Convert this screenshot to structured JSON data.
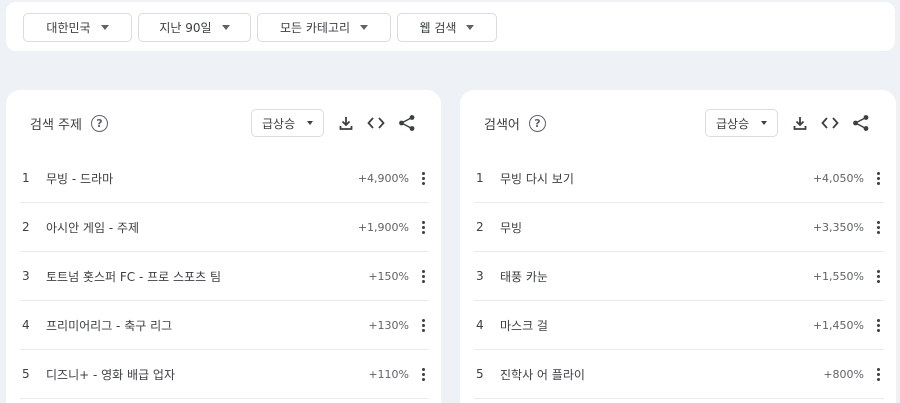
{
  "filters": [
    {
      "label": "대한민국"
    },
    {
      "label": "지난 90일"
    },
    {
      "label": "모든 카테고리"
    },
    {
      "label": "웹 검색"
    }
  ],
  "topics": {
    "title": "검색 주제",
    "sort_label": "급상승",
    "rows": [
      {
        "rank": "1",
        "label": "무빙 - 드라마",
        "value": "+4,900%"
      },
      {
        "rank": "2",
        "label": "아시안 게임 - 주제",
        "value": "+1,900%"
      },
      {
        "rank": "3",
        "label": "토트넘 홋스퍼 FC - 프로 스포츠 팀",
        "value": "+150%"
      },
      {
        "rank": "4",
        "label": "프리미어리그 - 축구 리그",
        "value": "+130%"
      },
      {
        "rank": "5",
        "label": "디즈니+ - 영화 배급 업자",
        "value": "+110%"
      }
    ]
  },
  "queries": {
    "title": "검색어",
    "sort_label": "급상승",
    "rows": [
      {
        "rank": "1",
        "label": "무빙 다시 보기",
        "value": "+4,050%"
      },
      {
        "rank": "2",
        "label": "무빙",
        "value": "+3,350%"
      },
      {
        "rank": "3",
        "label": "태풍 카눈",
        "value": "+1,550%"
      },
      {
        "rank": "4",
        "label": "마스크 걸",
        "value": "+1,450%"
      },
      {
        "rank": "5",
        "label": "진학사 어 플라이",
        "value": "+800%"
      }
    ]
  },
  "icons": {
    "help": "help-circle-icon",
    "download": "download-icon",
    "embed": "code-embed-icon",
    "share": "share-icon",
    "more": "more-vert-icon"
  }
}
